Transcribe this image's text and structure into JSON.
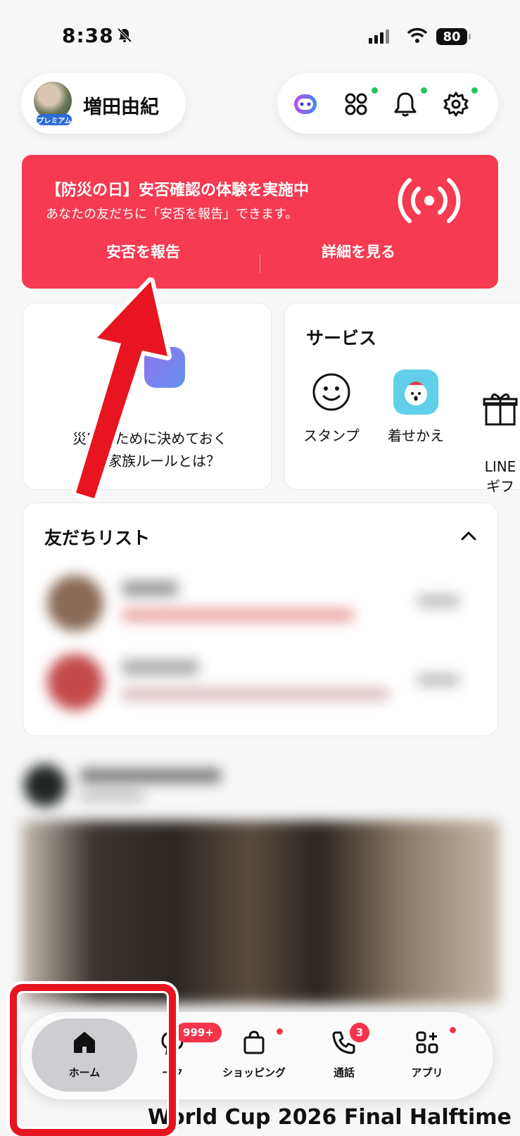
{
  "status_bar": {
    "time": "8:38",
    "battery": "80"
  },
  "header": {
    "username": "増田由紀",
    "premium_badge": "プレミアム"
  },
  "banner": {
    "title": "【防災の日】安否確認の体験を実施中",
    "subtitle": "あなたの友だちに「安否を報告」できます。",
    "report_button": "安否を報告",
    "details_button": "詳細を見る"
  },
  "promo_card": {
    "text": "災害　ために決めておく\n　　家族ルールとは？"
  },
  "services": {
    "title": "サービス",
    "items": [
      {
        "label": "スタンプ",
        "icon": "smiley-icon"
      },
      {
        "label": "着せかえ",
        "icon": "theme-character-icon"
      },
      {
        "label": "LINE\nギフ",
        "icon": "gift-icon"
      }
    ]
  },
  "friends": {
    "title": "友だちリスト"
  },
  "feed": {
    "post_title": "World Cup 2026 Final Halftime"
  },
  "tabbar": {
    "tabs": [
      {
        "label": "ホーム",
        "icon": "home-icon"
      },
      {
        "label": "ーク",
        "icon": "chat-icon",
        "badge": "999+"
      },
      {
        "label": "ショッピング",
        "icon": "shopping-bag-icon"
      },
      {
        "label": "通話",
        "icon": "phone-icon",
        "badge": "3"
      },
      {
        "label": "アプリ",
        "icon": "apps-icon"
      }
    ]
  },
  "colors": {
    "banner": "#f53a52",
    "annotation": "#e8141f",
    "badge": "#f5344b",
    "online_dot": "#22c55e"
  }
}
